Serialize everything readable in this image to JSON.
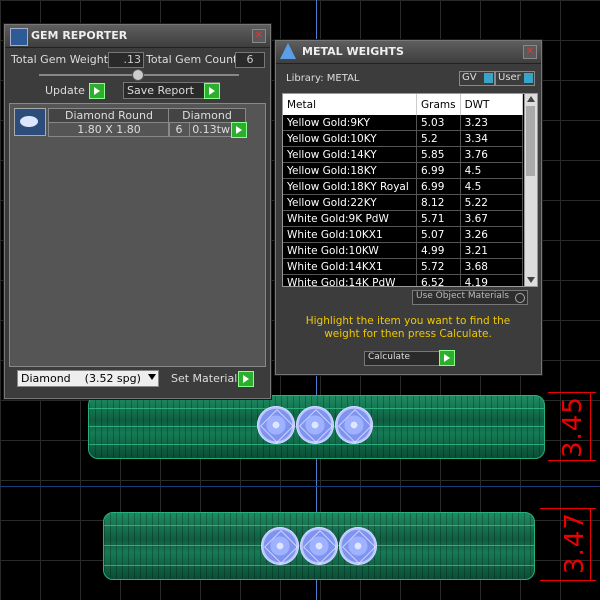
{
  "gem_reporter": {
    "title": "GEM REPORTER",
    "weight_label": "Total Gem Weight",
    "weight_value": ".13",
    "count_label": "Total Gem Count",
    "count_value": "6",
    "update_label": "Update",
    "save_label": "Save Report",
    "columns": [
      "Diamond Round",
      "Diamond"
    ],
    "row": {
      "size": "1.80 X 1.80",
      "count": "6",
      "tw": "0.13tw"
    },
    "material_select": "Diamond    (3.52 spg)",
    "set_material_label": "Set Material"
  },
  "metal_weights": {
    "title": "METAL WEIGHTS",
    "library_label": "Library: METAL",
    "gv_label": "GV",
    "user_label": "User",
    "columns": [
      "Metal",
      "Grams",
      "DWT"
    ],
    "rows": [
      {
        "metal": "Yellow Gold:9KY",
        "grams": "5.03",
        "dwt": "3.23"
      },
      {
        "metal": "Yellow Gold:10KY",
        "grams": "5.2",
        "dwt": "3.34"
      },
      {
        "metal": "Yellow Gold:14KY",
        "grams": "5.85",
        "dwt": "3.76"
      },
      {
        "metal": "Yellow Gold:18KY",
        "grams": "6.99",
        "dwt": "4.5"
      },
      {
        "metal": "Yellow Gold:18KY Royal",
        "grams": "6.99",
        "dwt": "4.5"
      },
      {
        "metal": "Yellow Gold:22KY",
        "grams": "8.12",
        "dwt": "5.22"
      },
      {
        "metal": "White Gold:9K PdW",
        "grams": "5.71",
        "dwt": "3.67"
      },
      {
        "metal": "White Gold:10KX1",
        "grams": "5.07",
        "dwt": "3.26"
      },
      {
        "metal": "White Gold:10KW",
        "grams": "4.99",
        "dwt": "3.21"
      },
      {
        "metal": "White Gold:14KX1",
        "grams": "5.72",
        "dwt": "3.68"
      },
      {
        "metal": "White Gold:14K PdW",
        "grams": "6.52",
        "dwt": "4.19"
      }
    ],
    "use_object_materials": "Use Object Materials",
    "instruction": "Highlight the item you want to find the weight for then press Calculate.",
    "calculate_label": "Calculate"
  },
  "dimensions": {
    "top": "3.45",
    "bottom": "3.47"
  },
  "colors": {
    "dimension": "#ee0000",
    "instruction": "#f0c800",
    "ring": "#1e8c63",
    "gem": "#9fb2ff"
  }
}
